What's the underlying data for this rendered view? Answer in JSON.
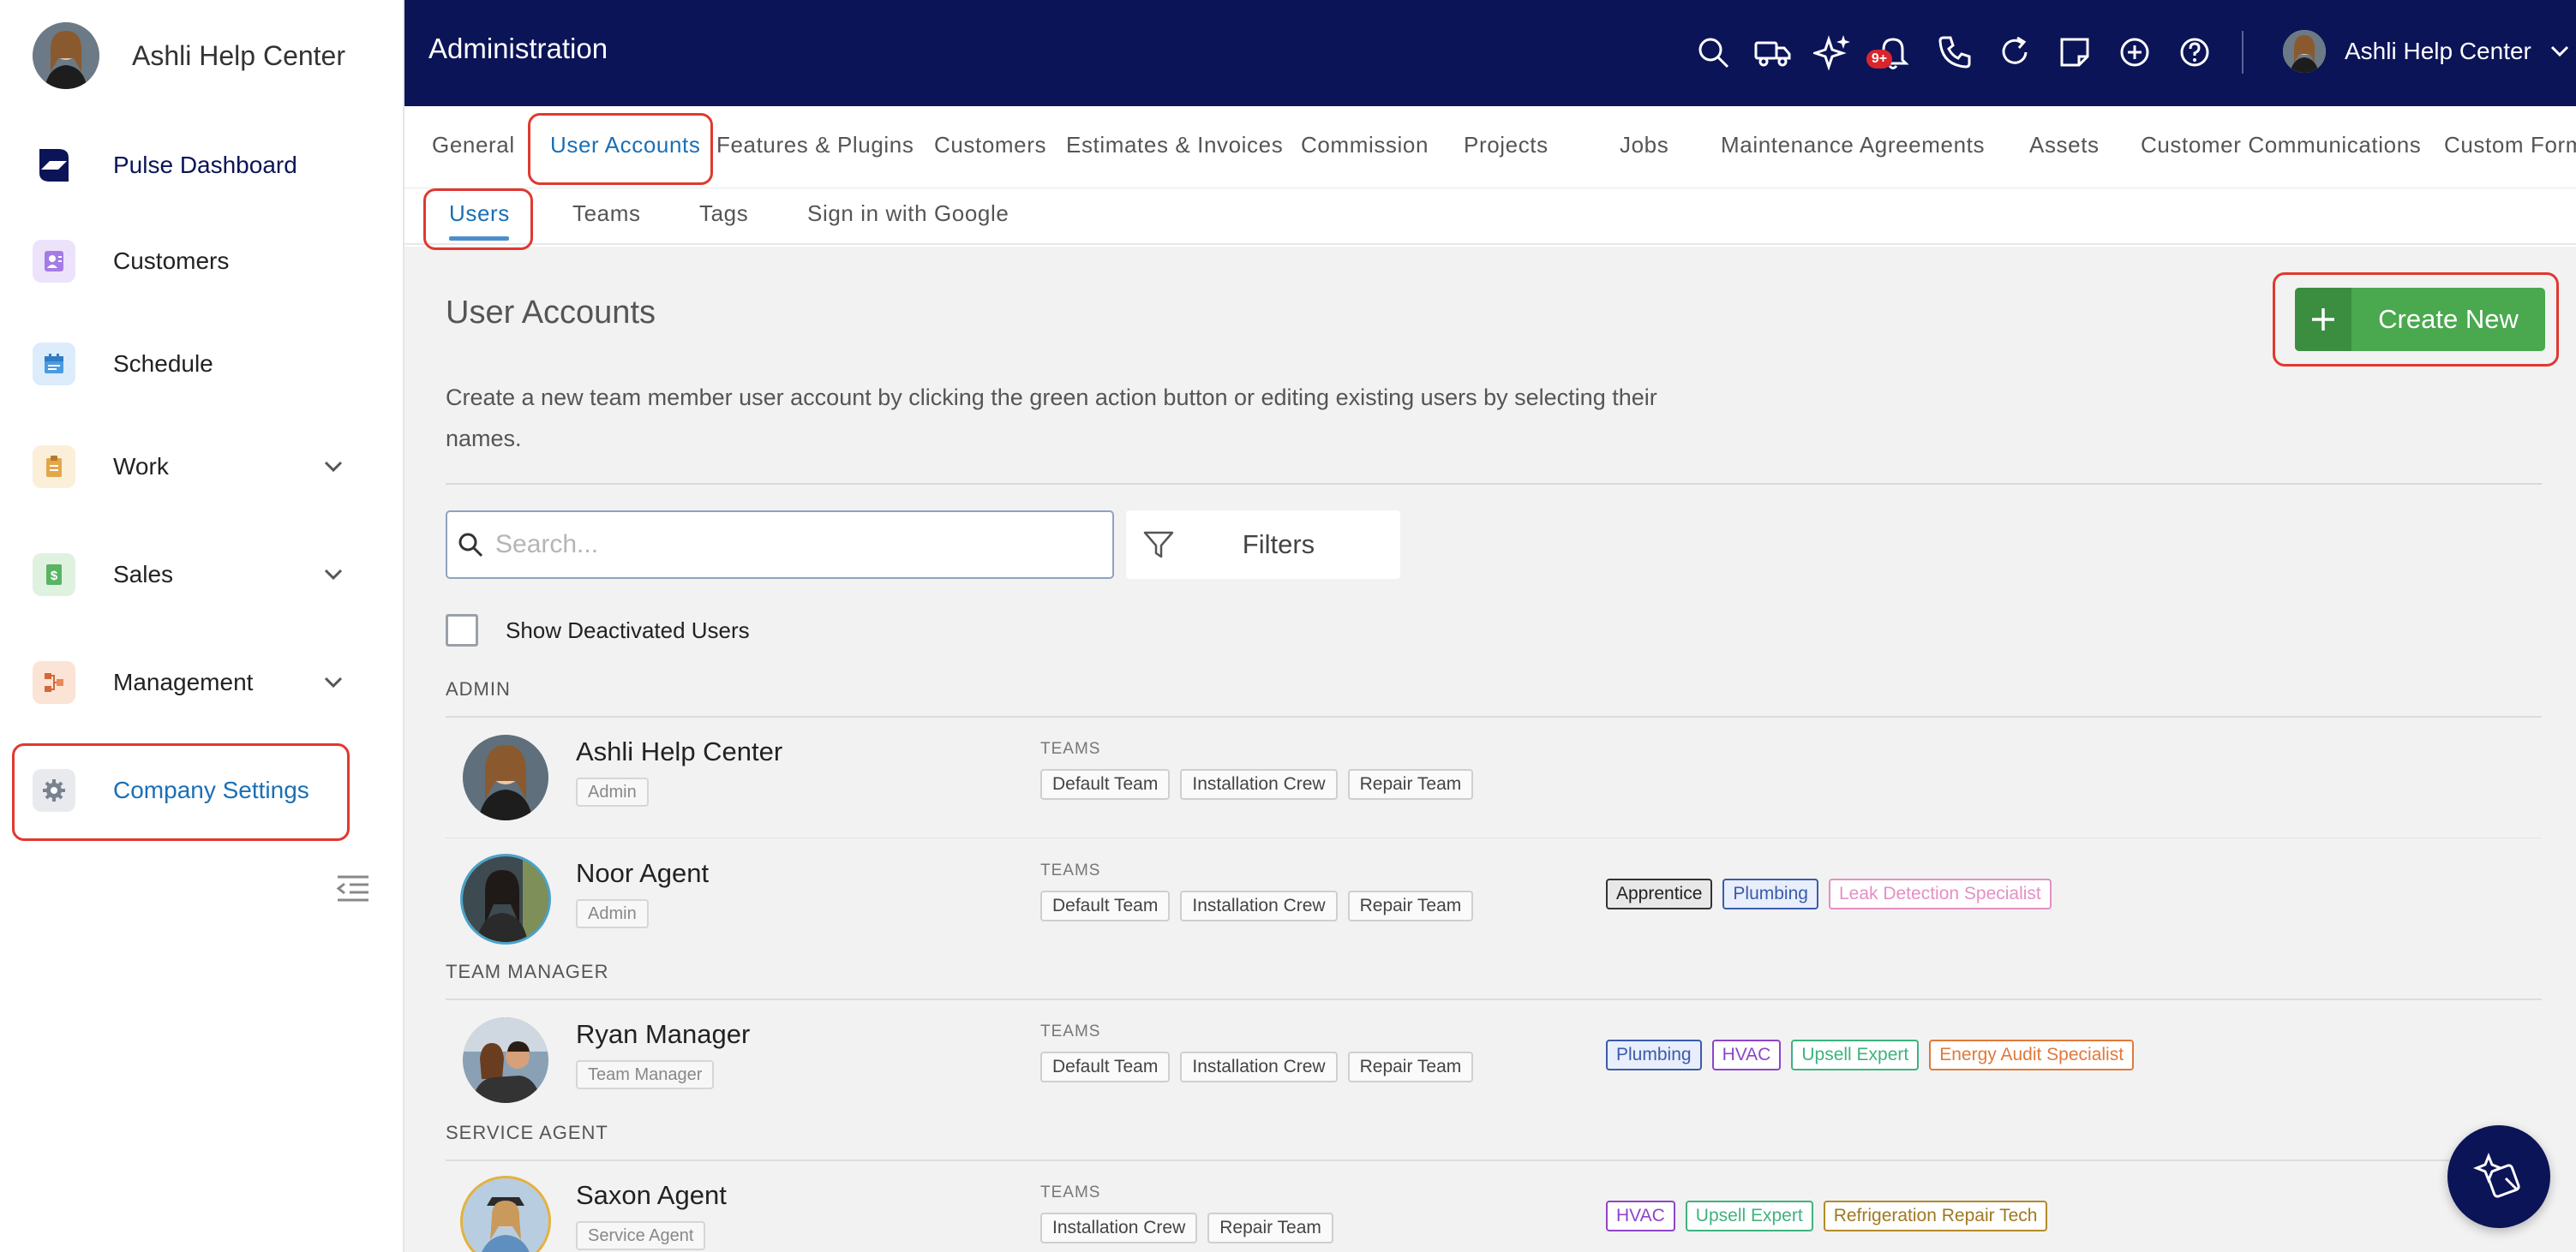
{
  "sidebar": {
    "account_name": "Ashli Help Center",
    "items": [
      {
        "label": "Pulse Dashboard",
        "icon": "pulse-logo-icon"
      },
      {
        "label": "Customers",
        "icon": "contact-card-icon"
      },
      {
        "label": "Schedule",
        "icon": "calendar-icon"
      },
      {
        "label": "Work",
        "icon": "clipboard-icon"
      },
      {
        "label": "Sales",
        "icon": "dollar-document-icon"
      },
      {
        "label": "Management",
        "icon": "org-chart-icon"
      },
      {
        "label": "Company Settings",
        "icon": "gear-icon"
      }
    ]
  },
  "header": {
    "title": "Administration",
    "notification_badge": "9+",
    "user_name": "Ashli Help Center"
  },
  "tabs": [
    "General",
    "User Accounts",
    "Features & Plugins",
    "Customers",
    "Estimates & Invoices",
    "Commission",
    "Projects",
    "Jobs",
    "Maintenance Agreements",
    "Assets",
    "Customer Communications",
    "Custom Form"
  ],
  "subtabs": [
    "Users",
    "Teams",
    "Tags",
    "Sign in with Google"
  ],
  "main": {
    "title": "User Accounts",
    "description": "Create a new team member user account by clicking the green action button or editing existing users by selecting their names.",
    "create_button": "Create New",
    "search_placeholder": "Search...",
    "filters_label": "Filters",
    "show_deactivated": "Show Deactivated Users",
    "teams_heading": "TEAMS"
  },
  "groups": [
    {
      "label": "ADMIN",
      "users": [
        {
          "name": "Ashli Help Center",
          "role": "Admin",
          "teams": [
            "Default Team",
            "Installation Crew",
            "Repair Team"
          ],
          "skills": []
        },
        {
          "name": "Noor Agent",
          "role": "Admin",
          "teams": [
            "Default Team",
            "Installation Crew",
            "Repair Team"
          ],
          "skills": [
            "Apprentice",
            "Plumbing",
            "Leak Detection Specialist"
          ]
        }
      ]
    },
    {
      "label": "TEAM MANAGER",
      "users": [
        {
          "name": "Ryan Manager",
          "role": "Team Manager",
          "teams": [
            "Default Team",
            "Installation Crew",
            "Repair Team"
          ],
          "skills": [
            "Plumbing",
            "HVAC",
            "Upsell Expert",
            "Energy Audit Specialist"
          ]
        }
      ]
    },
    {
      "label": "SERVICE AGENT",
      "users": [
        {
          "name": "Saxon Agent",
          "role": "Service Agent",
          "teams": [
            "Installation Crew",
            "Repair Team"
          ],
          "skills": [
            "HVAC",
            "Upsell Expert",
            "Refrigeration Repair Tech"
          ]
        }
      ]
    }
  ],
  "colors": {
    "topbar": "#0b1457",
    "accent": "#1a6fb5",
    "create_green": "#4aa84f",
    "highlight": "#e0392f",
    "tag_apprentice": "#333333",
    "tag_plumbing": "#3b5bab",
    "tag_leak": "#e58fc4",
    "tag_hvac": "#8e44c9",
    "tag_upsell": "#3fb27f",
    "tag_energy": "#e07a3a",
    "tag_refrigeration": "#b38a2a"
  }
}
